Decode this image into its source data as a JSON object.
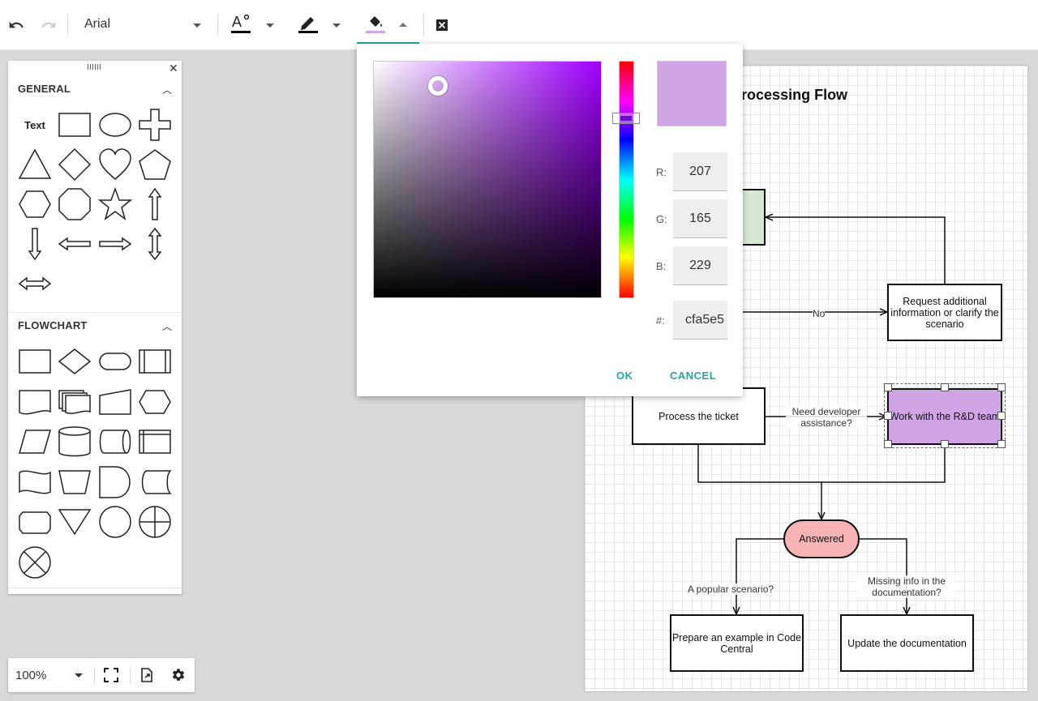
{
  "toolbar": {
    "font_family": "Arial",
    "icons": [
      "undo-icon",
      "redo-icon",
      "font-color-icon",
      "line-color-icon",
      "fill-color-icon",
      "clear-icon"
    ],
    "font_color": "#000000",
    "line_color": "#000000",
    "fill_color": "#cfa5e5"
  },
  "panel": {
    "general": {
      "title": "GENERAL",
      "text_item": "Text",
      "shapes": [
        "text",
        "rectangle",
        "ellipse",
        "cross",
        "triangle",
        "diamond",
        "heart",
        "pentagon",
        "hexagon",
        "octagon",
        "star",
        "arrow-up",
        "arrow-down",
        "arrow-left",
        "arrow-right",
        "arrow-up-down",
        "arrow-left-right"
      ]
    },
    "flowchart": {
      "title": "FLOWCHART",
      "shapes": [
        "process",
        "decision",
        "terminator",
        "predefined-process",
        "document",
        "multiple-documents",
        "manual-input",
        "preparation",
        "data",
        "database",
        "direct-access-storage",
        "internal-storage",
        "paper-tape",
        "manual-operation",
        "delay",
        "stored-data",
        "display",
        "merge",
        "connector",
        "or",
        "summing-junction"
      ]
    }
  },
  "diagram": {
    "title": "Ticket Processing Flow",
    "title_visible": "cket Processing Flow",
    "nodes": {
      "request_info": "Request additional information or clarify the scenario",
      "process_ticket": "Process the ticket",
      "work_rd": "Work with the R&D team",
      "answered": "Answered",
      "prepare_example": "Prepare an example in Code Central",
      "update_docs": "Update the documentation"
    },
    "labels": {
      "no": "No",
      "need_dev": "Need developer assistance?",
      "popular": "A popular scenario?",
      "missing": "Missing info in the documentation?"
    },
    "colors": {
      "green_node": "#d5e8d4",
      "work_rd_fill": "#cfa5e5",
      "answered_fill": "#f8b4b4"
    }
  },
  "color_picker": {
    "r_label": "R:",
    "g_label": "G:",
    "b_label": "B:",
    "hex_label": "#:",
    "r": "207",
    "g": "165",
    "b": "229",
    "hex": "cfa5e5",
    "preview_color": "#cfa5e5",
    "ok_label": "OK",
    "cancel_label": "CANCEL"
  },
  "zoom": {
    "value": "100%",
    "icons": [
      "fullscreen-icon",
      "export-icon",
      "settings-icon"
    ]
  }
}
